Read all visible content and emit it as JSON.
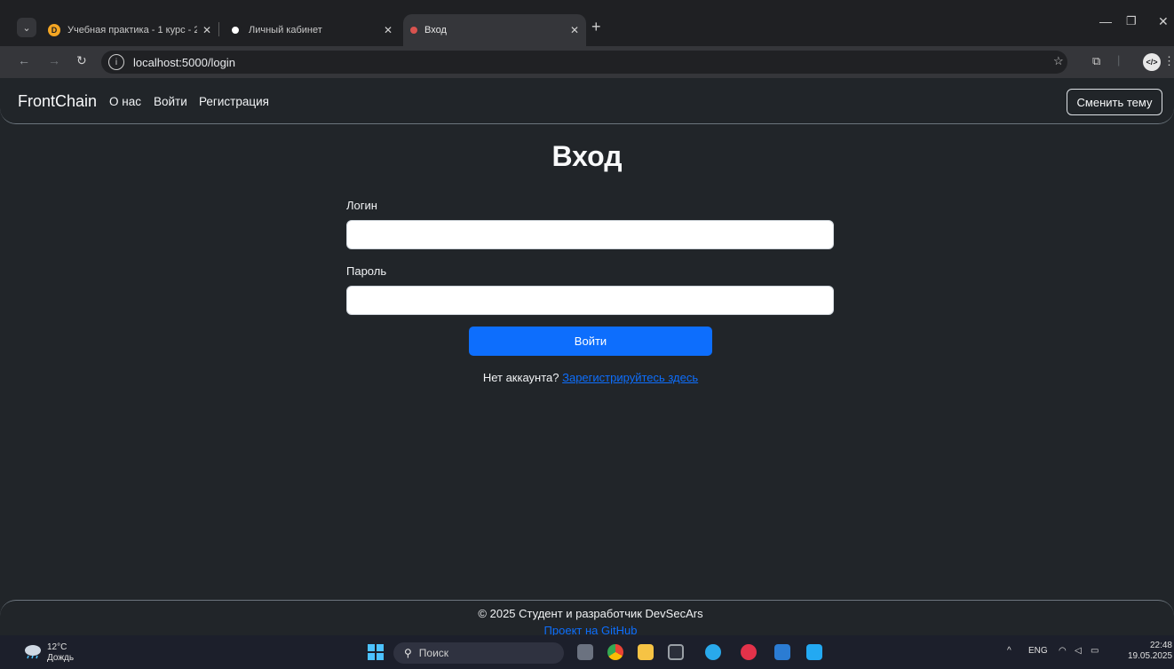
{
  "browser": {
    "tabs": [
      {
        "title": "Учебная практика - 1 курс - 2(",
        "favicon": "D",
        "favicon_color": "#f5a623"
      },
      {
        "title": "Личный кабинет",
        "favicon": "",
        "favicon_color": "#ffffff"
      },
      {
        "title": "Вход",
        "favicon": "",
        "favicon_color": "#d9534f"
      }
    ],
    "new_tab": "+",
    "url": "localhost:5000/login",
    "ext_badge": "</>"
  },
  "navbar": {
    "brand": "FrontChain",
    "links": [
      "О нас",
      "Войти",
      "Регистрация"
    ],
    "theme_button": "Сменить тему"
  },
  "login": {
    "heading": "Вход",
    "login_label": "Логин",
    "login_value": "",
    "password_label": "Пароль",
    "password_value": "",
    "submit": "Войти",
    "no_account": "Нет аккаунта? ",
    "register_link": "Зарегистрируйтесь здесь"
  },
  "footer": {
    "copyright": "© 2025 Студент и разработчик DevSecArs",
    "github_link": "Проект на GitHub"
  },
  "taskbar": {
    "temperature": "12°C",
    "weather": "Дождь",
    "search_placeholder": "Поиск",
    "language": "ENG",
    "time": "22:48",
    "date": "19.05.2025"
  },
  "colors": {
    "page_bg": "#212529",
    "primary": "#0d6efd"
  }
}
